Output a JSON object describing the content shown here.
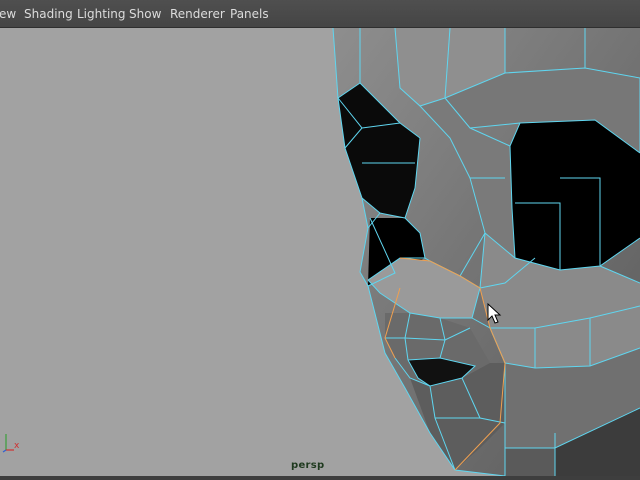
{
  "menubar": {
    "items": [
      {
        "label": "ew",
        "name": "menu-view"
      },
      {
        "label": "Shading",
        "name": "menu-shading"
      },
      {
        "label": "Lighting",
        "name": "menu-lighting"
      },
      {
        "label": "Show",
        "name": "menu-show"
      },
      {
        "label": "Renderer",
        "name": "menu-renderer"
      },
      {
        "label": "Panels",
        "name": "menu-panels"
      }
    ]
  },
  "viewport": {
    "camera": "persp",
    "axis_x": "x",
    "axis_y": "y"
  },
  "colors": {
    "background": "#a2a2a2",
    "wireframe": "#5fd6f0",
    "selection": "#f0a050",
    "mesh_light": "#8a8a8a",
    "mesh_dark": "#4a4a4a",
    "interior": "#000000"
  },
  "icons": [
    "axis-gizmo-icon",
    "mouse-cursor-icon"
  ]
}
